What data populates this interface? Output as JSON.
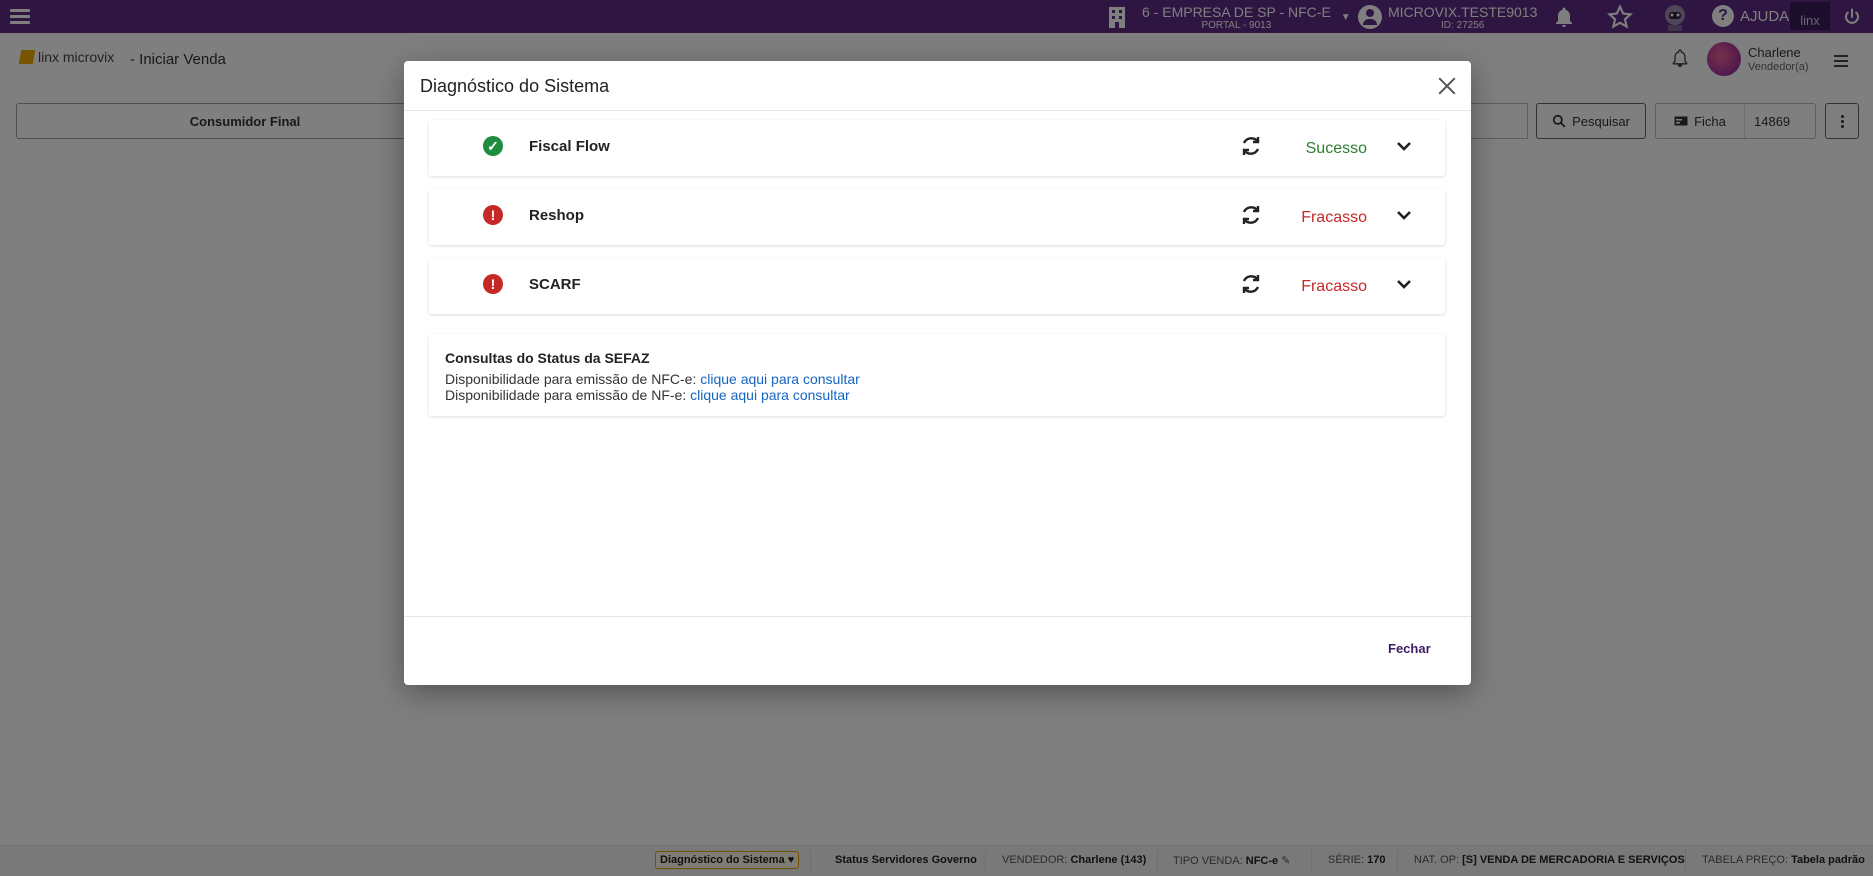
{
  "topbar": {
    "company_line1": "6 - EMPRESA DE SP - NFC-E",
    "company_line2": "PORTAL - 9013",
    "user_line1": "MICROVIX.TESTE9013",
    "user_line2": "ID: 27256",
    "help_label": "AJUDA",
    "brand_label": "linx",
    "color": "#5c2b84"
  },
  "header": {
    "logo_text": "linx microvix",
    "page_title": "- Iniciar Venda",
    "user_name": "Charlene",
    "user_role": "Vendedor(a)"
  },
  "actions": {
    "consumer_label": "Consumidor Final",
    "search_label": "Pesquisar",
    "ficha_label": "Ficha",
    "ficha_number": "14869"
  },
  "modal": {
    "title": "Diagnóstico do Sistema",
    "services": [
      {
        "name": "Fiscal Flow",
        "status": "Sucesso",
        "state": "success"
      },
      {
        "name": "Reshop",
        "status": "Fracasso",
        "state": "failure"
      },
      {
        "name": "SCARF",
        "status": "Fracasso",
        "state": "failure"
      }
    ],
    "sefaz": {
      "title": "Consultas do Status da SEFAZ",
      "nfce_text": "Disponibilidade para emissão de NFC-e: ",
      "nfce_link": "clique aqui para consultar",
      "nfe_text": "Disponibilidade para emissão de NF-e: ",
      "nfe_link": "clique aqui para consultar"
    },
    "close_label": "Fechar"
  },
  "statusbar": {
    "diagnostic_label": "Diagnóstico do Sistema",
    "gov_servers_label": "Status Servidores Governo",
    "vendedor_label": "VENDEDOR:",
    "vendedor_value": "Charlene (143)",
    "tipo_venda_label": "TIPO VENDA:",
    "tipo_venda_value": "NFC-e",
    "serie_label": "SÉRIE:",
    "serie_value": "170",
    "nat_op_label": "NAT. OP:",
    "nat_op_value": "[S] VENDA DE MERCADORIA E SERVIÇOS",
    "tabela_label": "TABELA PREÇO:",
    "tabela_value": "Tabela padrão"
  },
  "colors": {
    "success": "#2e7d32",
    "failure": "#c62828",
    "link": "#1565c0"
  }
}
